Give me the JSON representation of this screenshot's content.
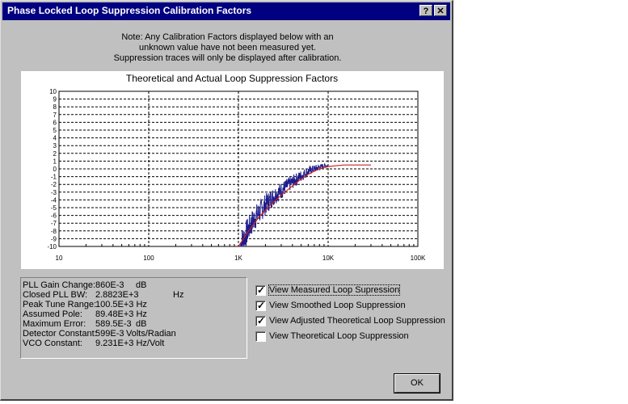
{
  "window": {
    "title": "Phase Locked Loop Suppression Calibration Factors",
    "help_label": "?",
    "close_label": "✕"
  },
  "note": {
    "lines": [
      "Note: Any Calibration Factors displayed below with an",
      "unknown value have not been measured yet.",
      "Suppression traces will only be displayed after calibration."
    ]
  },
  "chart_data": {
    "type": "line",
    "title": "Theoretical and Actual Loop Suppression Factors",
    "xlabel": "",
    "ylabel": "",
    "x_scale": "log",
    "xlim": [
      10,
      100000
    ],
    "ylim": [
      -10,
      10
    ],
    "x_tick_labels": [
      "10",
      "100",
      "1K",
      "10K",
      "100K"
    ],
    "x_tick_values": [
      10,
      100,
      1000,
      10000,
      100000
    ],
    "y_tick_values": [
      10,
      9,
      8,
      7,
      6,
      5,
      4,
      3,
      2,
      1,
      0,
      -1,
      -2,
      -3,
      -4,
      -5,
      -6,
      -7,
      -8,
      -9,
      -10
    ],
    "y_tick_labels": [
      "10",
      "9",
      "8",
      "7",
      "6",
      "5",
      "4",
      "3",
      "2",
      "1",
      "0",
      "-1",
      "-2",
      "-3",
      "-4",
      "-5",
      "-6",
      "-7",
      "-8",
      "-9",
      "-10"
    ],
    "grid": true,
    "series": [
      {
        "color": "#1c1c8c",
        "style": "noisy",
        "x": [
          1050,
          1200,
          1400,
          1600,
          1800,
          2000,
          2300,
          2600,
          3000,
          3500,
          4000,
          4500,
          5000,
          5500,
          6000,
          7000,
          8000,
          9000,
          10000
        ],
        "y": [
          -9.8,
          -8.5,
          -7.0,
          -6.0,
          -5.3,
          -4.6,
          -3.9,
          -3.3,
          -2.8,
          -2.2,
          -1.7,
          -1.3,
          -0.9,
          -0.6,
          -0.3,
          0.0,
          0.2,
          0.4,
          0.4
        ]
      },
      {
        "color": "#cc2222",
        "style": "solid",
        "x": [
          1000,
          1300,
          1700,
          2200,
          3000,
          4000,
          5000,
          6000,
          7000,
          8000,
          9000,
          10000,
          12000,
          15000,
          20000,
          30000
        ],
        "y": [
          -10.0,
          -8.0,
          -6.2,
          -4.8,
          -3.4,
          -2.2,
          -1.3,
          -0.7,
          -0.3,
          0.0,
          0.2,
          0.3,
          0.4,
          0.5,
          0.5,
          0.5
        ]
      }
    ]
  },
  "info": {
    "rows": [
      {
        "label": "PLL Gain Change:",
        "value": "860E-3",
        "unit": "dB",
        "unit_offset": 140
      },
      {
        "label": "Closed PLL BW:",
        "value": "2.8823E+3",
        "unit": "Hz",
        "unit_offset": 186
      },
      {
        "label": "Peak Tune Range:",
        "value": "100.5E+3 Hz",
        "unit": "",
        "unit_offset": 0
      },
      {
        "label": "Assumed Pole:",
        "value": "89.48E+3 Hz",
        "unit": "",
        "unit_offset": 0
      },
      {
        "label": "Maximum Error:",
        "value": "589.5E-3",
        "unit": "dB",
        "unit_offset": 140
      },
      {
        "label": "Detector Constant:",
        "value": "599E-3",
        "unit": "Volts/Radian",
        "unit_offset": 128
      },
      {
        "label": "VCO Constant:",
        "value": "9.231E+3 Hz/Volt",
        "unit": "",
        "unit_offset": 0
      }
    ]
  },
  "checkboxes": [
    {
      "id": "measured",
      "label": "View Measured Loop Supression",
      "checked": true,
      "focused": true
    },
    {
      "id": "smoothed",
      "label": "View Smoothed Loop Suppression",
      "checked": true,
      "focused": false
    },
    {
      "id": "adjusted",
      "label": "View Adjusted Theoretical Loop Suppression",
      "checked": true,
      "focused": false
    },
    {
      "id": "theoretical",
      "label": "View Theoretical Loop Suppression",
      "checked": false,
      "focused": false
    }
  ],
  "ok_label": "OK"
}
